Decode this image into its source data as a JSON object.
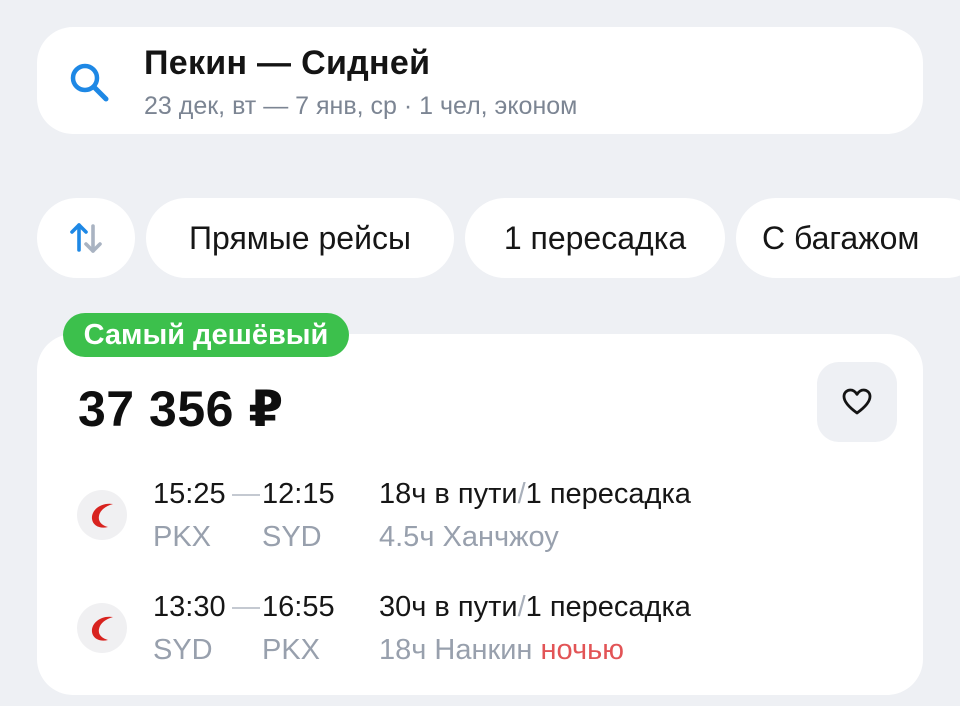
{
  "search": {
    "route": "Пекин — Сидней",
    "details": "23 дек, вт — 7 янв, ср · 1 чел, эконом",
    "icon": "search-icon"
  },
  "filters": {
    "sort_icon": "sort-arrows-icon",
    "chips": [
      {
        "label": "Прямые рейсы"
      },
      {
        "label": "1 пересадка"
      },
      {
        "label": "С багажом"
      }
    ]
  },
  "ticket": {
    "badge": "Самый дешёвый",
    "price": "37 356 ₽",
    "favorite_icon": "heart-icon",
    "segments": [
      {
        "depart_time": "15:25",
        "arrive_time": "12:15",
        "depart_code": "PKX",
        "arrive_code": "SYD",
        "duration": "18ч в пути",
        "separator": "/",
        "transfers": "1 пересадка",
        "layover": "4.5ч Ханчжоу",
        "night_note": ""
      },
      {
        "depart_time": "13:30",
        "arrive_time": "16:55",
        "depart_code": "SYD",
        "arrive_code": "PKX",
        "duration": "30ч в пути",
        "separator": "/",
        "transfers": "1 пересадка",
        "layover": "18ч Нанкин",
        "night_note": "ночью"
      }
    ]
  },
  "colors": {
    "background": "#eef0f4",
    "badge_green": "#3cc04c",
    "accent_blue": "#1e88e5",
    "airline_red": "#d8231f",
    "night_red": "#e25456",
    "muted_text": "#98a0ad"
  }
}
